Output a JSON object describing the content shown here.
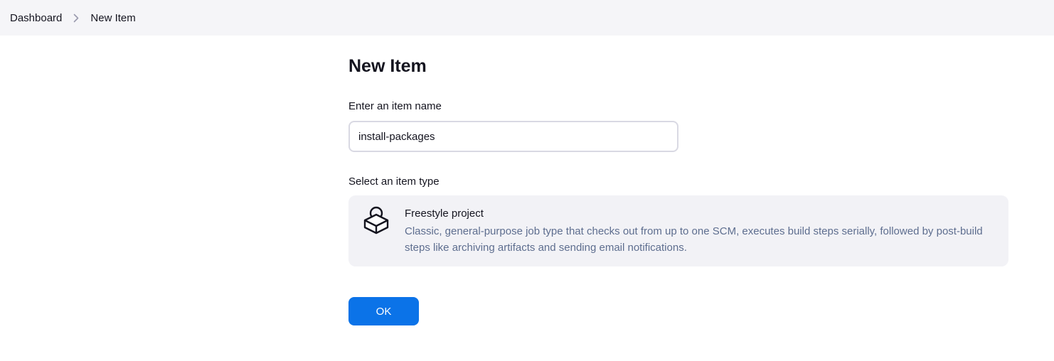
{
  "breadcrumb": {
    "items": [
      {
        "label": "Dashboard"
      },
      {
        "label": "New Item"
      }
    ],
    "separator_icon": "chevron-right-icon"
  },
  "page": {
    "title": "New Item"
  },
  "name_field": {
    "label": "Enter an item name",
    "value": "install-packages"
  },
  "type_section": {
    "label": "Select an item type",
    "options": [
      {
        "icon": "package-icon",
        "name": "Freestyle project",
        "description": "Classic, general-purpose job type that checks out from up to one SCM, executes build steps serially, followed by post-build steps like archiving artifacts and sending email notifications."
      }
    ]
  },
  "actions": {
    "ok_label": "OK"
  },
  "colors": {
    "topbar_bg": "#f5f5f8",
    "card_bg": "#f2f2f6",
    "primary": "#0b73e8",
    "description_text": "#5e6e8f"
  }
}
